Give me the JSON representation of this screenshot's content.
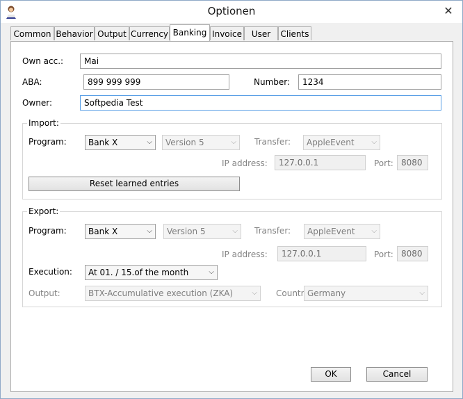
{
  "window": {
    "title": "Optionen",
    "close_glyph": "✕"
  },
  "tabs": [
    {
      "label": "Common"
    },
    {
      "label": "Behavior"
    },
    {
      "label": "Output"
    },
    {
      "label": "Currency"
    },
    {
      "label": "Banking"
    },
    {
      "label": "Invoice"
    },
    {
      "label": "User"
    },
    {
      "label": "Clients"
    }
  ],
  "active_tab": "Banking",
  "account": {
    "own_acc_label": "Own acc.:",
    "own_acc_value": "Mai",
    "aba_label": "ABA:",
    "aba_value": "899 999 999",
    "number_label": "Number:",
    "number_value": "1234",
    "owner_label": "Owner:",
    "owner_value": "Softpedia Test"
  },
  "import": {
    "title": "Import:",
    "program_label": "Program:",
    "program_value": "Bank X",
    "version_value": "Version 5",
    "transfer_label": "Transfer:",
    "transfer_value": "AppleEvent",
    "ip_label": "IP address:",
    "ip_value": "127.0.0.1",
    "port_label": "Port:",
    "port_value": "8080",
    "reset_button": "Reset learned entries"
  },
  "export": {
    "title": "Export:",
    "program_label": "Program:",
    "program_value": "Bank X",
    "version_value": "Version 5",
    "transfer_label": "Transfer:",
    "transfer_value": "AppleEvent",
    "ip_label": "IP address:",
    "ip_value": "127.0.0.1",
    "port_label": "Port:",
    "port_value": "8080",
    "execution_label": "Execution:",
    "execution_value": "At 01. / 15.of the month",
    "output_label": "Output:",
    "output_value": "BTX-Accumulative execution (ZKA)",
    "country_label": "Countr",
    "country_value": "Germany"
  },
  "buttons": {
    "ok": "OK",
    "cancel": "Cancel"
  },
  "icons": {
    "dropdown": "⌵"
  },
  "colors": {
    "focus_border": "#569de5",
    "disabled_text": "#838383"
  }
}
